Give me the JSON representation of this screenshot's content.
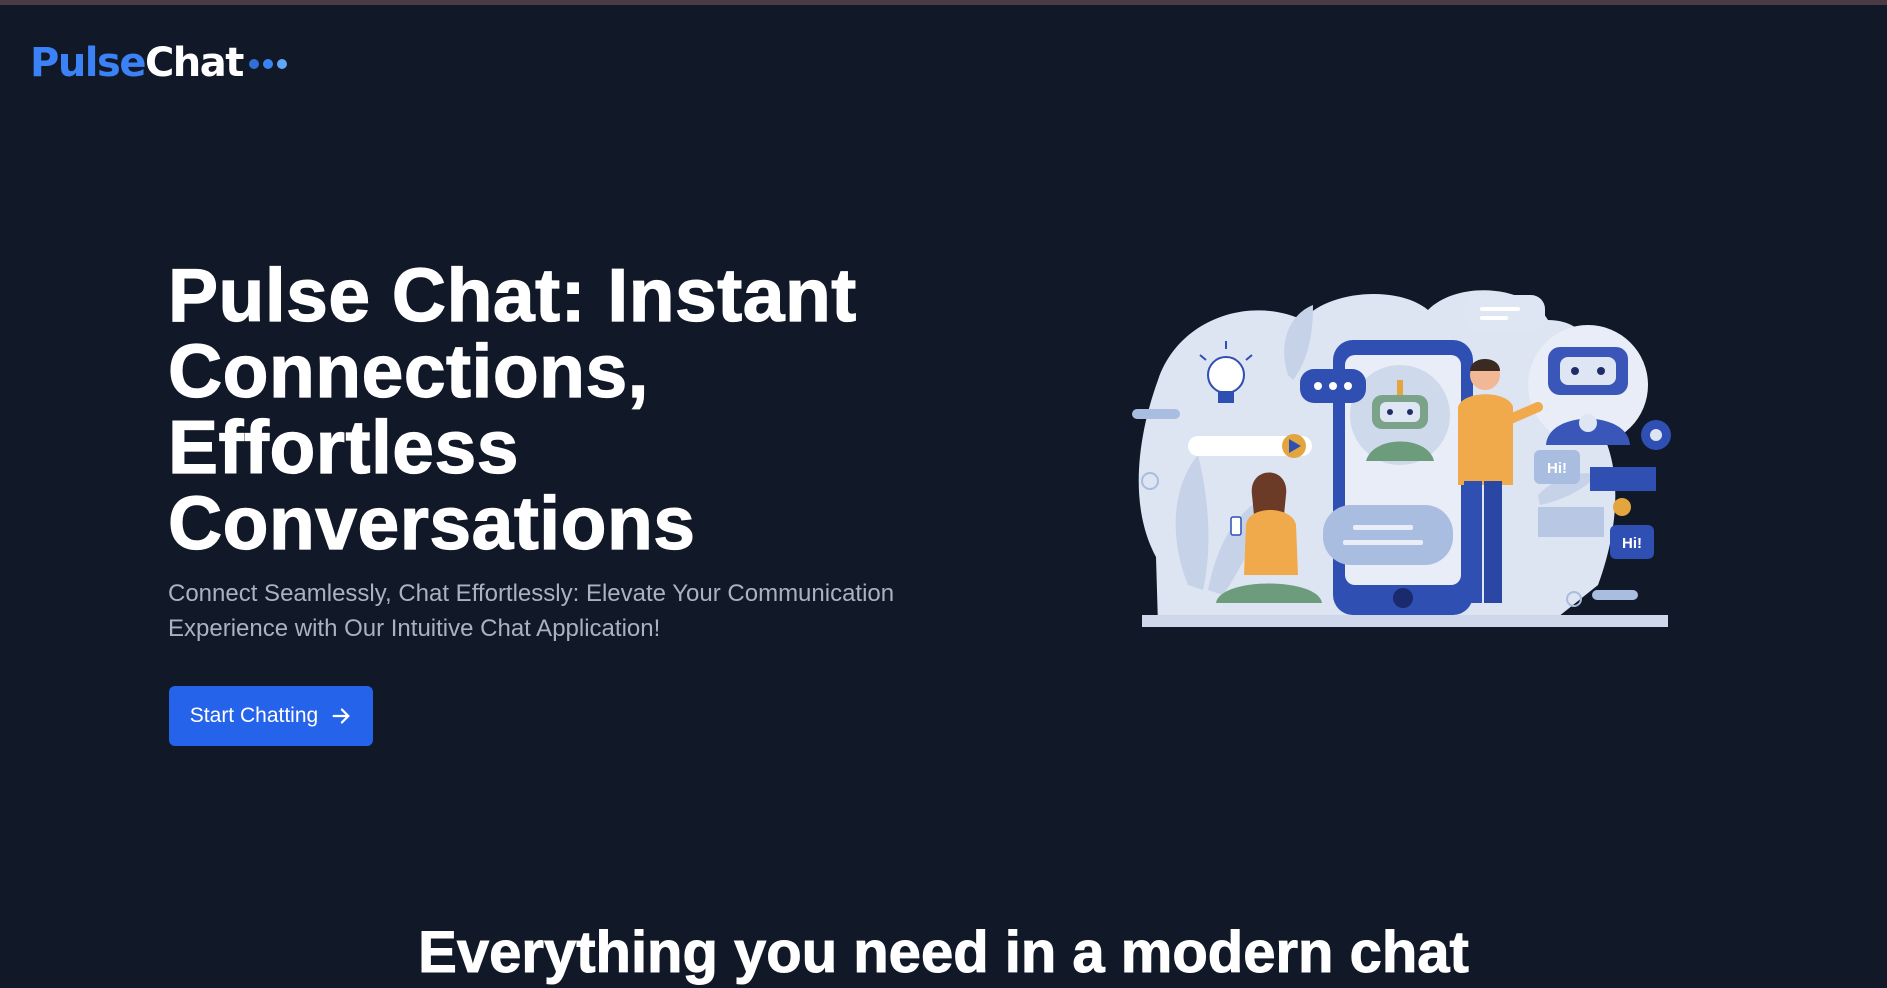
{
  "brand": {
    "part1": "Pulse",
    "part2": "Chat",
    "colors": {
      "part1": "#3b82f6",
      "part2": "#ffffff",
      "dots": [
        "#2f6fd6",
        "#3b82f6",
        "#60a5fa"
      ]
    }
  },
  "hero": {
    "title": "Pulse Chat: Instant Connections, Effortless Conversations",
    "subtitle": "Connect Seamlessly, Chat Effortlessly: Elevate Your Communication Experience with Our Intuitive Chat Application!",
    "cta_label": "Start Chatting",
    "cta_icon": "arrow-right-icon"
  },
  "illustration": {
    "bubble_hi_1": "Hi!",
    "bubble_hi_2": "Hi!"
  },
  "features": {
    "title": "Everything you need in a modern chat"
  },
  "colors": {
    "background": "#111827",
    "accent": "#2563eb",
    "subtitle": "#aab2bf"
  }
}
